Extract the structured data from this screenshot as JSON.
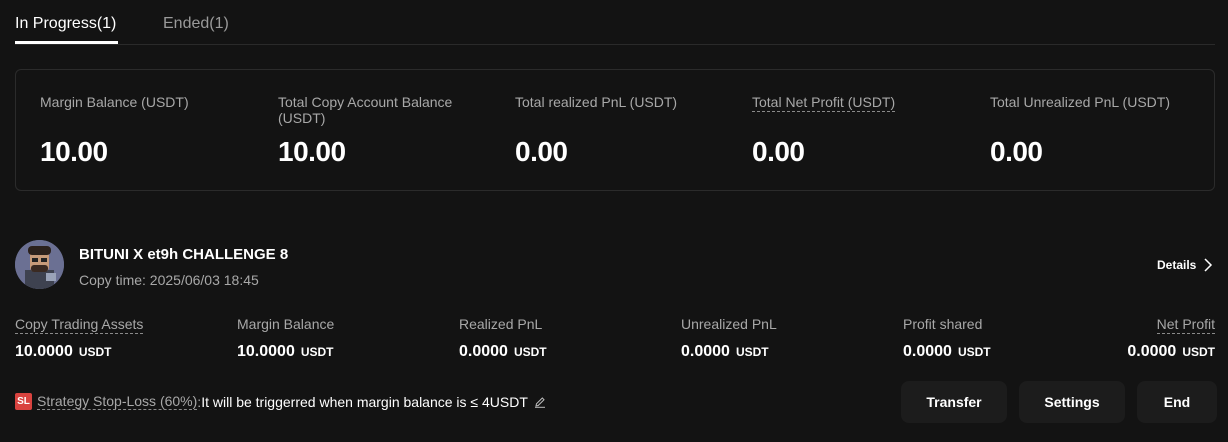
{
  "tabs": [
    {
      "label": "In Progress(1)",
      "active": true
    },
    {
      "label": "Ended(1)",
      "active": false
    }
  ],
  "summary": [
    {
      "label": "Margin Balance (USDT)",
      "value": "10.00",
      "dotted": false
    },
    {
      "label": "Total Copy Account Balance (USDT)",
      "value": "10.00",
      "dotted": false
    },
    {
      "label": "Total realized PnL (USDT)",
      "value": "0.00",
      "dotted": false
    },
    {
      "label": "Total Net Profit (USDT)",
      "value": "0.00",
      "dotted": true
    },
    {
      "label": "Total Unrealized PnL (USDT)",
      "value": "0.00",
      "dotted": false
    }
  ],
  "strategy": {
    "name": "BITUNI X et9h CHALLENGE 8",
    "copy_time": "Copy time: 2025/06/03 18:45",
    "details_label": "Details"
  },
  "stats": [
    {
      "label": "Copy Trading Assets",
      "value": "10.0000",
      "unit": "USDT"
    },
    {
      "label": "Margin Balance",
      "value": "10.0000",
      "unit": "USDT"
    },
    {
      "label": "Realized PnL",
      "value": "0.0000",
      "unit": "USDT"
    },
    {
      "label": "Unrealized PnL",
      "value": "0.0000",
      "unit": "USDT"
    },
    {
      "label": "Profit shared",
      "value": "0.0000",
      "unit": "USDT"
    },
    {
      "label": "Net Profit",
      "value": "0.0000",
      "unit": "USDT"
    }
  ],
  "stop_loss": {
    "badge": "SL",
    "label": "Strategy Stop-Loss (60%)",
    "colon": ":",
    "text": "It will be triggerred when margin balance is ≤ 4USDT"
  },
  "actions": {
    "transfer": "Transfer",
    "settings": "Settings",
    "end": "End"
  },
  "colors": {
    "background": "#131313",
    "badge_red": "#d9433f",
    "button_bg": "#1c1c1c"
  }
}
